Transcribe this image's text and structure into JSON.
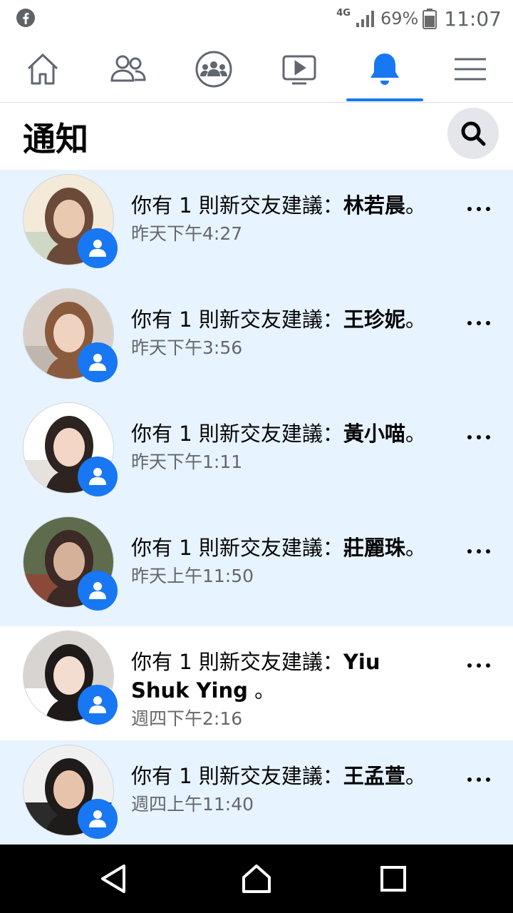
{
  "status_bar": {
    "network": "4G",
    "battery": "69%",
    "time": "11:07",
    "icons": [
      "facebook-icon",
      "signal-icon",
      "battery-icon"
    ]
  },
  "tabs": [
    {
      "name": "home",
      "icon": "home-icon"
    },
    {
      "name": "friends",
      "icon": "friends-icon"
    },
    {
      "name": "groups",
      "icon": "groups-icon"
    },
    {
      "name": "watch",
      "icon": "video-icon"
    },
    {
      "name": "notifications",
      "icon": "bell-icon",
      "active": true
    },
    {
      "name": "menu",
      "icon": "hamburger-menu-icon"
    }
  ],
  "header": {
    "title": "通知",
    "search_icon": "search-icon"
  },
  "notifications": [
    {
      "prefix": "你有 1 則新交友建議：",
      "name": "林若晨",
      "suffix": "。",
      "time": "昨天下午4:27",
      "unread": true
    },
    {
      "prefix": "你有 1 則新交友建議：",
      "name": "王珍妮",
      "suffix": "。",
      "time": "昨天下午3:56",
      "unread": true
    },
    {
      "prefix": "你有 1 則新交友建議：",
      "name": "黃小喵",
      "suffix": "。",
      "time": "昨天下午1:11",
      "unread": true
    },
    {
      "prefix": "你有 1 則新交友建議：",
      "name": "莊麗珠",
      "suffix": "。",
      "time": "昨天上午11:50",
      "unread": true
    },
    {
      "prefix": "你有 1 則新交友建議：",
      "name": "Yiu Shuk Ying",
      "suffix": " 。",
      "time": "週四下午2:16",
      "unread": false
    },
    {
      "prefix": "你有 1 則新交友建議：",
      "name": "王孟萱",
      "suffix": "。",
      "time": "週四上午11:40",
      "unread": true
    }
  ],
  "colors": {
    "accent": "#1877f2",
    "unread_bg": "#e7f3ff",
    "secondary_text": "#65676b"
  }
}
